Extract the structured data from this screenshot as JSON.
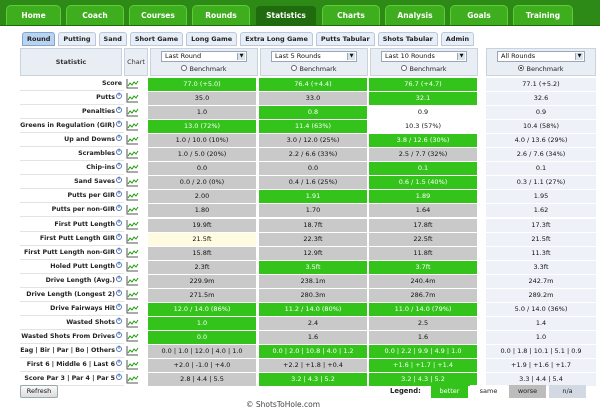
{
  "topnav": [
    "Home",
    "Coach",
    "Courses",
    "Rounds",
    "Statistics",
    "Charts",
    "Analysis",
    "Goals",
    "Training"
  ],
  "topnav_active": 4,
  "subtabs": [
    "Round",
    "Putting",
    "Sand",
    "Short Game",
    "Long Game",
    "Extra Long Game",
    "Putts Tabular",
    "Shots Tabular",
    "Admin"
  ],
  "subtabs_active": 0,
  "header": {
    "statistic": "Statistic",
    "chart": "Chart",
    "col1_select": "Last Round",
    "col2_select": "Last 5 Rounds",
    "col3_select": "Last 10 Rounds",
    "col4_select": "All Rounds",
    "benchmark": "Benchmark"
  },
  "rows": [
    {
      "label": "Score",
      "info": false,
      "v": [
        "77.0 (+5.0)",
        "76.4 (+4.4)",
        "76.7 (+4.7)",
        "77.1 (+5.2)"
      ],
      "s": [
        "better",
        "better",
        "better",
        "na"
      ]
    },
    {
      "label": "Putts",
      "info": true,
      "v": [
        "35.0",
        "33.0",
        "32.1",
        "32.6"
      ],
      "s": [
        "worse",
        "worse",
        "better",
        "na"
      ]
    },
    {
      "label": "Penalties",
      "info": true,
      "v": [
        "1.0",
        "0.8",
        "0.9",
        "0.9"
      ],
      "s": [
        "worse",
        "better",
        "same",
        "na"
      ]
    },
    {
      "label": "Greens in Regulation (GIR)",
      "info": true,
      "v": [
        "13.0 (72%)",
        "11.4 (63%)",
        "10.3 (57%)",
        "10.4 (58%)"
      ],
      "s": [
        "better",
        "better",
        "same",
        "na"
      ]
    },
    {
      "label": "Up and Downs",
      "info": true,
      "v": [
        "1.0 / 10.0 (10%)",
        "3.0 / 12.0 (25%)",
        "3.8 / 12.6 (30%)",
        "4.0 / 13.6 (29%)"
      ],
      "s": [
        "worse",
        "worse",
        "better",
        "na"
      ]
    },
    {
      "label": "Scrambles",
      "info": true,
      "v": [
        "1.0 / 5.0 (20%)",
        "2.2 / 6.6 (33%)",
        "2.5 / 7.7 (32%)",
        "2.6 / 7.6 (34%)"
      ],
      "s": [
        "worse",
        "worse",
        "worse",
        "na"
      ]
    },
    {
      "label": "Chip-ins",
      "info": true,
      "v": [
        "0.0",
        "0.0",
        "0.1",
        "0.1"
      ],
      "s": [
        "worse",
        "worse",
        "better",
        "na"
      ]
    },
    {
      "label": "Sand Saves",
      "info": true,
      "v": [
        "0.0 / 2.0 (0%)",
        "0.4 / 1.6 (25%)",
        "0.6 / 1.5 (40%)",
        "0.3 / 1.1 (27%)"
      ],
      "s": [
        "worse",
        "worse",
        "better",
        "na"
      ]
    },
    {
      "label": "Putts per GIR",
      "info": true,
      "v": [
        "2.00",
        "1.91",
        "1.89",
        "1.95"
      ],
      "s": [
        "worse",
        "better",
        "better",
        "na"
      ]
    },
    {
      "label": "Putts per non-GIR",
      "info": true,
      "v": [
        "1.80",
        "1.70",
        "1.64",
        "1.62"
      ],
      "s": [
        "worse",
        "worse",
        "worse",
        "na"
      ]
    },
    {
      "label": "First Putt Length",
      "info": true,
      "v": [
        "19.9ft",
        "18.7ft",
        "17.8ft",
        "17.3ft"
      ],
      "s": [
        "worse",
        "worse",
        "worse",
        "na"
      ]
    },
    {
      "label": "First Putt Length GIR",
      "info": true,
      "v": [
        "21.5ft",
        "22.3ft",
        "22.5ft",
        "21.5ft"
      ],
      "s": [
        "hl",
        "worse",
        "worse",
        "na"
      ]
    },
    {
      "label": "First Putt Length non-GIR",
      "info": true,
      "v": [
        "15.8ft",
        "12.9ft",
        "11.8ft",
        "11.3ft"
      ],
      "s": [
        "worse",
        "worse",
        "worse",
        "na"
      ]
    },
    {
      "label": "Holed Putt Length",
      "info": true,
      "v": [
        "2.3ft",
        "3.5ft",
        "3.7ft",
        "3.3ft"
      ],
      "s": [
        "worse",
        "better",
        "better",
        "na"
      ]
    },
    {
      "label": "Drive Length (Avg.)",
      "info": true,
      "v": [
        "229.9m",
        "238.1m",
        "240.4m",
        "242.7m"
      ],
      "s": [
        "worse",
        "worse",
        "worse",
        "na"
      ]
    },
    {
      "label": "Drive Length (Longest 2)",
      "info": true,
      "v": [
        "271.5m",
        "280.3m",
        "286.7m",
        "289.2m"
      ],
      "s": [
        "worse",
        "worse",
        "worse",
        "na"
      ]
    },
    {
      "label": "Drive Fairways Hit",
      "info": true,
      "v": [
        "12.0 / 14.0 (86%)",
        "11.2 / 14.0 (80%)",
        "11.0 / 14.0 (79%)",
        "5.0 / 14.0 (36%)"
      ],
      "s": [
        "better",
        "better",
        "better",
        "na"
      ]
    },
    {
      "label": "Wasted Shots",
      "info": true,
      "v": [
        "1.0",
        "2.4",
        "2.5",
        "1.4"
      ],
      "s": [
        "better",
        "worse",
        "worse",
        "na"
      ]
    },
    {
      "label": "Wasted Shots From Drives",
      "info": true,
      "v": [
        "0.0",
        "1.6",
        "1.6",
        "1.0"
      ],
      "s": [
        "better",
        "worse",
        "worse",
        "na"
      ]
    },
    {
      "label": "Eag | Bir | Par | Bo | Others",
      "info": true,
      "v": [
        "0.0 | 1.0 | 12.0 | 4.0 | 1.0",
        "0.0 | 2.0 | 10.8 | 4.0 | 1.2",
        "0.0 | 2.2 | 9.9 | 4.9 | 1.0",
        "0.0 | 1.8 | 10.1 | 5.1 | 0.9"
      ],
      "s": [
        "worse",
        "better",
        "better",
        "na"
      ]
    },
    {
      "label": "First 6 | Middle 6 | Last 6",
      "info": true,
      "v": [
        "+2.0 | -1.0 | +4.0",
        "+2.2 | +1.8 | +0.4",
        "+1.6 | +1.7 | +1.4",
        "+1.9 | +1.6 | +1.7"
      ],
      "s": [
        "worse",
        "worse",
        "better",
        "na"
      ]
    },
    {
      "label": "Score Par 3 | Par 4 | Par 5",
      "info": true,
      "v": [
        "2.8 | 4.4 | 5.5",
        "3.2 | 4.3 | 5.2",
        "3.2 | 4.3 | 5.2",
        "3.3 | 4.4 | 5.4"
      ],
      "s": [
        "worse",
        "better",
        "better",
        "na"
      ]
    }
  ],
  "footer": {
    "refresh": "Refresh",
    "legend_label": "Legend:",
    "legend_better": "better",
    "legend_same": "same",
    "legend_worse": "worse",
    "legend_na": "n/a",
    "watermark": "© ShotsToHole.com"
  },
  "colors": {
    "better": "#33c31b",
    "worse": "#c9c9c9",
    "nav": "#2e8a16"
  }
}
